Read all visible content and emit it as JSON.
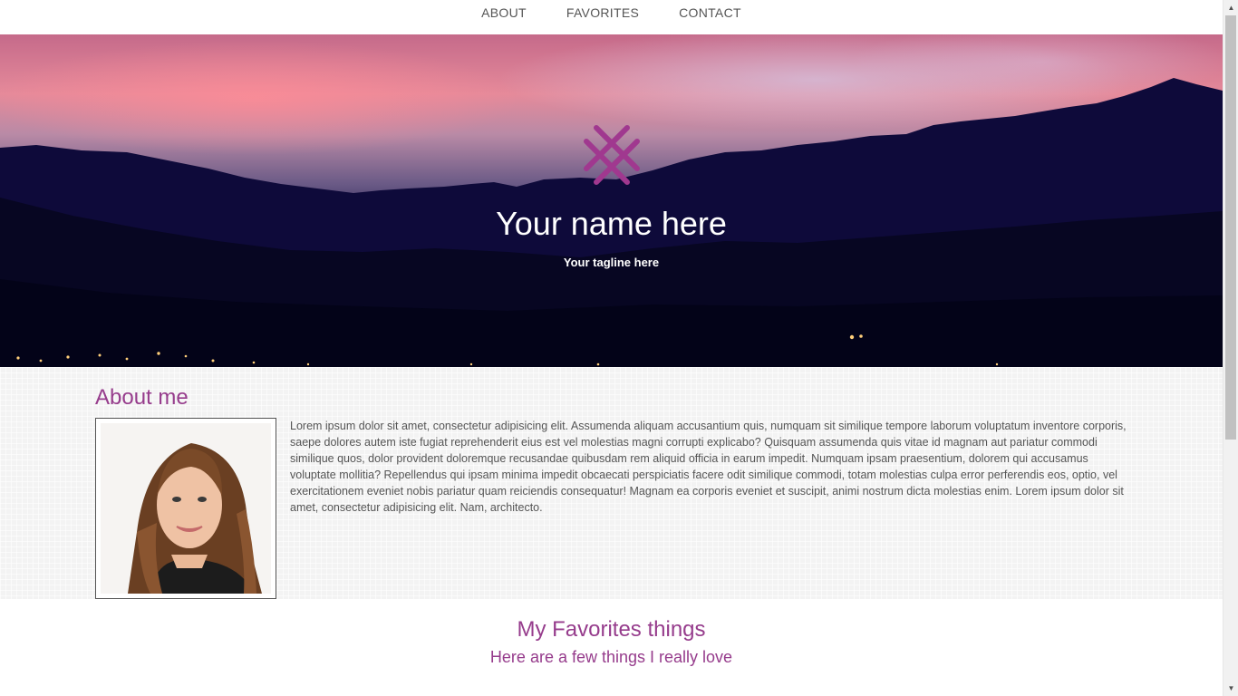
{
  "nav": {
    "items": [
      {
        "label": "ABOUT"
      },
      {
        "label": "FAVORITES"
      },
      {
        "label": "CONTACT"
      }
    ]
  },
  "hero": {
    "logo_icon": "crossed-lines-logo-icon",
    "title": "Your name here",
    "tagline": "Your tagline here"
  },
  "about": {
    "title": "About me",
    "photo_alt": "portrait-photo",
    "body": "Lorem ipsum dolor sit amet, consectetur adipisicing elit. Assumenda aliquam accusantium quis, numquam sit similique tempore laborum voluptatum inventore corporis, saepe dolores autem iste fugiat reprehenderit eius est vel molestias magni corrupti explicabo? Quisquam assumenda quis vitae id magnam aut pariatur commodi similique quos, dolor provident doloremque recusandae quibusdam rem aliquid officia in earum impedit. Numquam ipsam praesentium, dolorem qui accusamus voluptate mollitia? Repellendus qui ipsam minima impedit obcaecati perspiciatis facere odit similique commodi, totam molestias culpa error perferendis eos, optio, vel exercitationem eveniet nobis pariatur quam reiciendis consequatur! Magnam ea corporis eveniet et suscipit, animi nostrum dicta molestias enim. Lorem ipsum dolor sit amet, consectetur adipisicing elit. Nam, architecto."
  },
  "favorites": {
    "title": "My Favorites things",
    "subtitle": "Here are a few things I really love"
  },
  "colors": {
    "accent": "#963c8c",
    "logo": "#a0388f",
    "nav_text": "#555555"
  }
}
